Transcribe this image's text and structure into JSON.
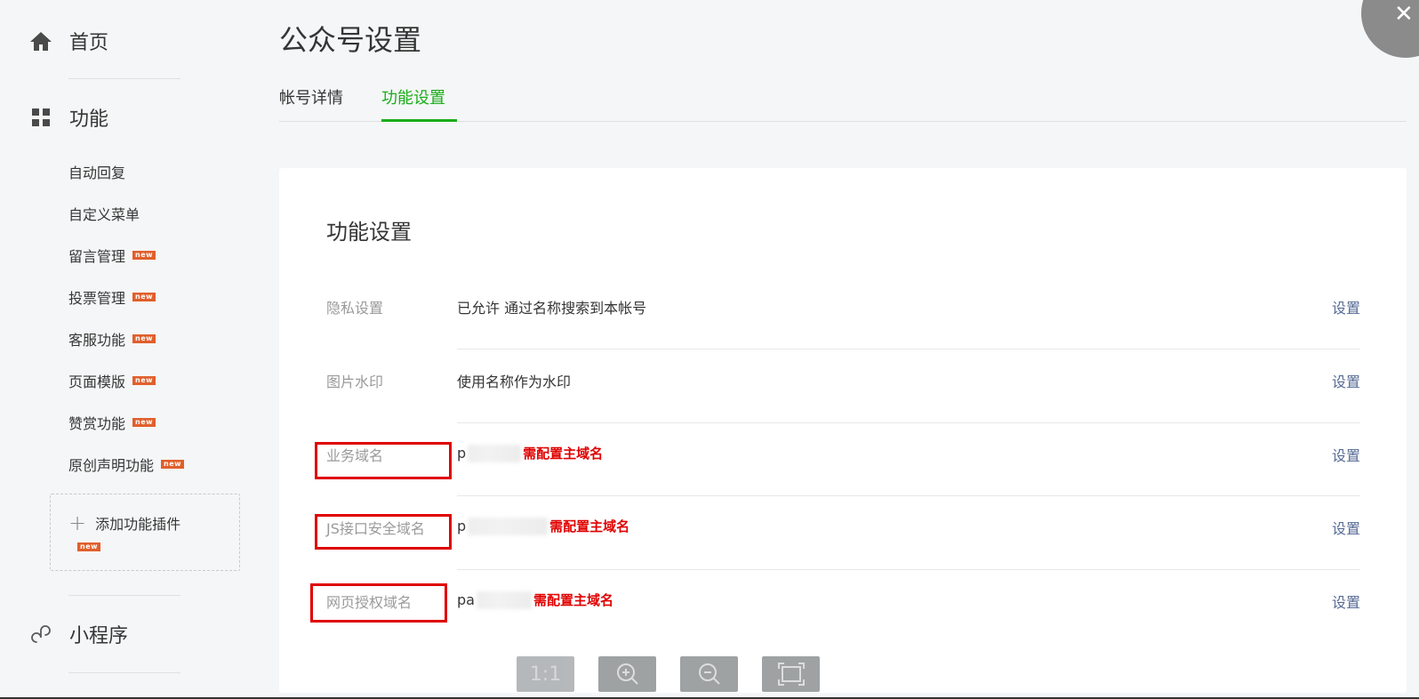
{
  "sidebar": {
    "home": "首页",
    "features": "功能",
    "sub_items": [
      {
        "label": "自动回复",
        "new": false
      },
      {
        "label": "自定义菜单",
        "new": false
      },
      {
        "label": "留言管理",
        "new": true
      },
      {
        "label": "投票管理",
        "new": true
      },
      {
        "label": "客服功能",
        "new": true
      },
      {
        "label": "页面模版",
        "new": true
      },
      {
        "label": "赞赏功能",
        "new": true
      },
      {
        "label": "原创声明功能",
        "new": true
      }
    ],
    "add_plugin": "添加功能插件",
    "new_badge": "new",
    "miniprogram": "小程序"
  },
  "header": {
    "title": "公众号设置",
    "tabs": [
      {
        "label": "帐号详情",
        "active": false
      },
      {
        "label": "功能设置",
        "active": true
      }
    ]
  },
  "card": {
    "title": "功能设置",
    "rows": [
      {
        "label": "隐私设置",
        "value": "已允许 通过名称搜索到本帐号",
        "action": "设置"
      },
      {
        "label": "图片水印",
        "value": "使用名称作为水印",
        "action": "设置"
      },
      {
        "label": "业务域名",
        "value_prefix": "p",
        "note": "需配置主域名",
        "action": "设置"
      },
      {
        "label": "JS接口安全域名",
        "value_prefix": "p",
        "note": "需配置主域名",
        "action": "设置"
      },
      {
        "label": "网页授权域名",
        "value_prefix": "pa",
        "note": "需配置主域名",
        "action": "设置"
      }
    ]
  },
  "zoom_toolbar": {
    "actual_size": "1:1",
    "zoom_in_icon": "zoom-in-icon",
    "zoom_out_icon": "zoom-out-icon",
    "fit_icon": "fit-screen-icon"
  },
  "colors": {
    "accent_green": "#1aad19",
    "link_blue": "#576b95",
    "annotation_red": "#e00000",
    "new_badge": "#e15f2c"
  }
}
